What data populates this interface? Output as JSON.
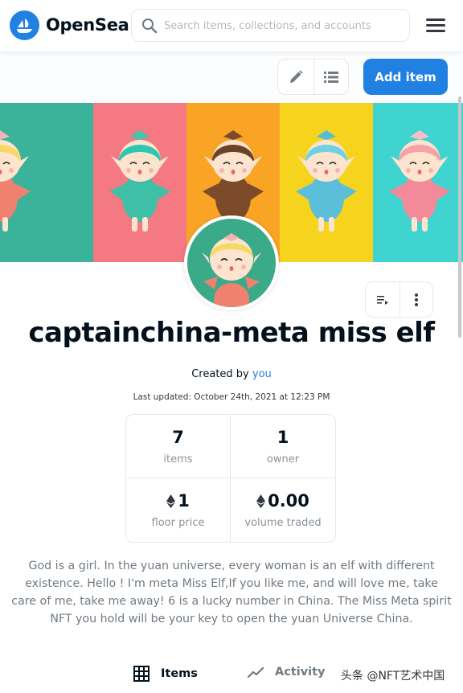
{
  "header": {
    "logo_text": "OpenSea",
    "search_placeholder": "Search items, collections, and accounts"
  },
  "toolbar": {
    "add_item_label": "Add item"
  },
  "banner": {
    "stripe_colors": [
      "#3ab39a",
      "#f47983",
      "#f9a424",
      "#f6d41e",
      "#3fd4d0",
      "#1ea5f0"
    ],
    "stripes": [
      {
        "hair": "#f7d866",
        "dress": "#f0806f",
        "bow": "#f5b4b4"
      },
      {
        "hair": "#2cc7b0",
        "dress": "#3fbfa7",
        "bow": "#3fc7a9"
      },
      {
        "hair": "#6d4326",
        "dress": "#7b4b2a",
        "bow": "#7b4b2a"
      },
      {
        "hair": "#6fd2e0",
        "dress": "#5bbfd9",
        "bow": "#56bcd6"
      },
      {
        "hair": "#f5a3a8",
        "dress": "#f28a99",
        "bow": "#f6c0c6"
      },
      {
        "hair": "#3a3a3a",
        "dress": "#9b9388",
        "bow": "#555555"
      }
    ]
  },
  "collection": {
    "title": "captainchina-meta miss elf",
    "created_by_prefix": "Created by",
    "created_by_link": "you",
    "last_updated": "Last updated: October 24th, 2021 at 12:23 PM"
  },
  "stats": [
    {
      "value": "7",
      "label": "items",
      "eth": false
    },
    {
      "value": "1",
      "label": "owner",
      "eth": false
    },
    {
      "value": "1",
      "label": "floor price",
      "eth": true
    },
    {
      "value": "0.00",
      "label": "volume traded",
      "eth": true
    }
  ],
  "description": "God is a girl. In the yuan universe, every woman is an elf with different existence. Hello ! I'm meta Miss Elf,If you like me, and will love me, take care of me, take me away! 6 is a lucky number in China. The Miss Meta spirit NFT you hold will be your key to open the yuan Universe China.",
  "tabs": [
    {
      "label": "Items",
      "icon": "grid-icon",
      "active": true
    },
    {
      "label": "Activity",
      "icon": "activity-icon",
      "active": false
    }
  ],
  "watermark": "头条 @NFT艺术中国",
  "colors": {
    "accent": "#2081e2",
    "text_primary": "#04111d",
    "text_secondary": "#707a83",
    "border": "#e5e8eb"
  }
}
